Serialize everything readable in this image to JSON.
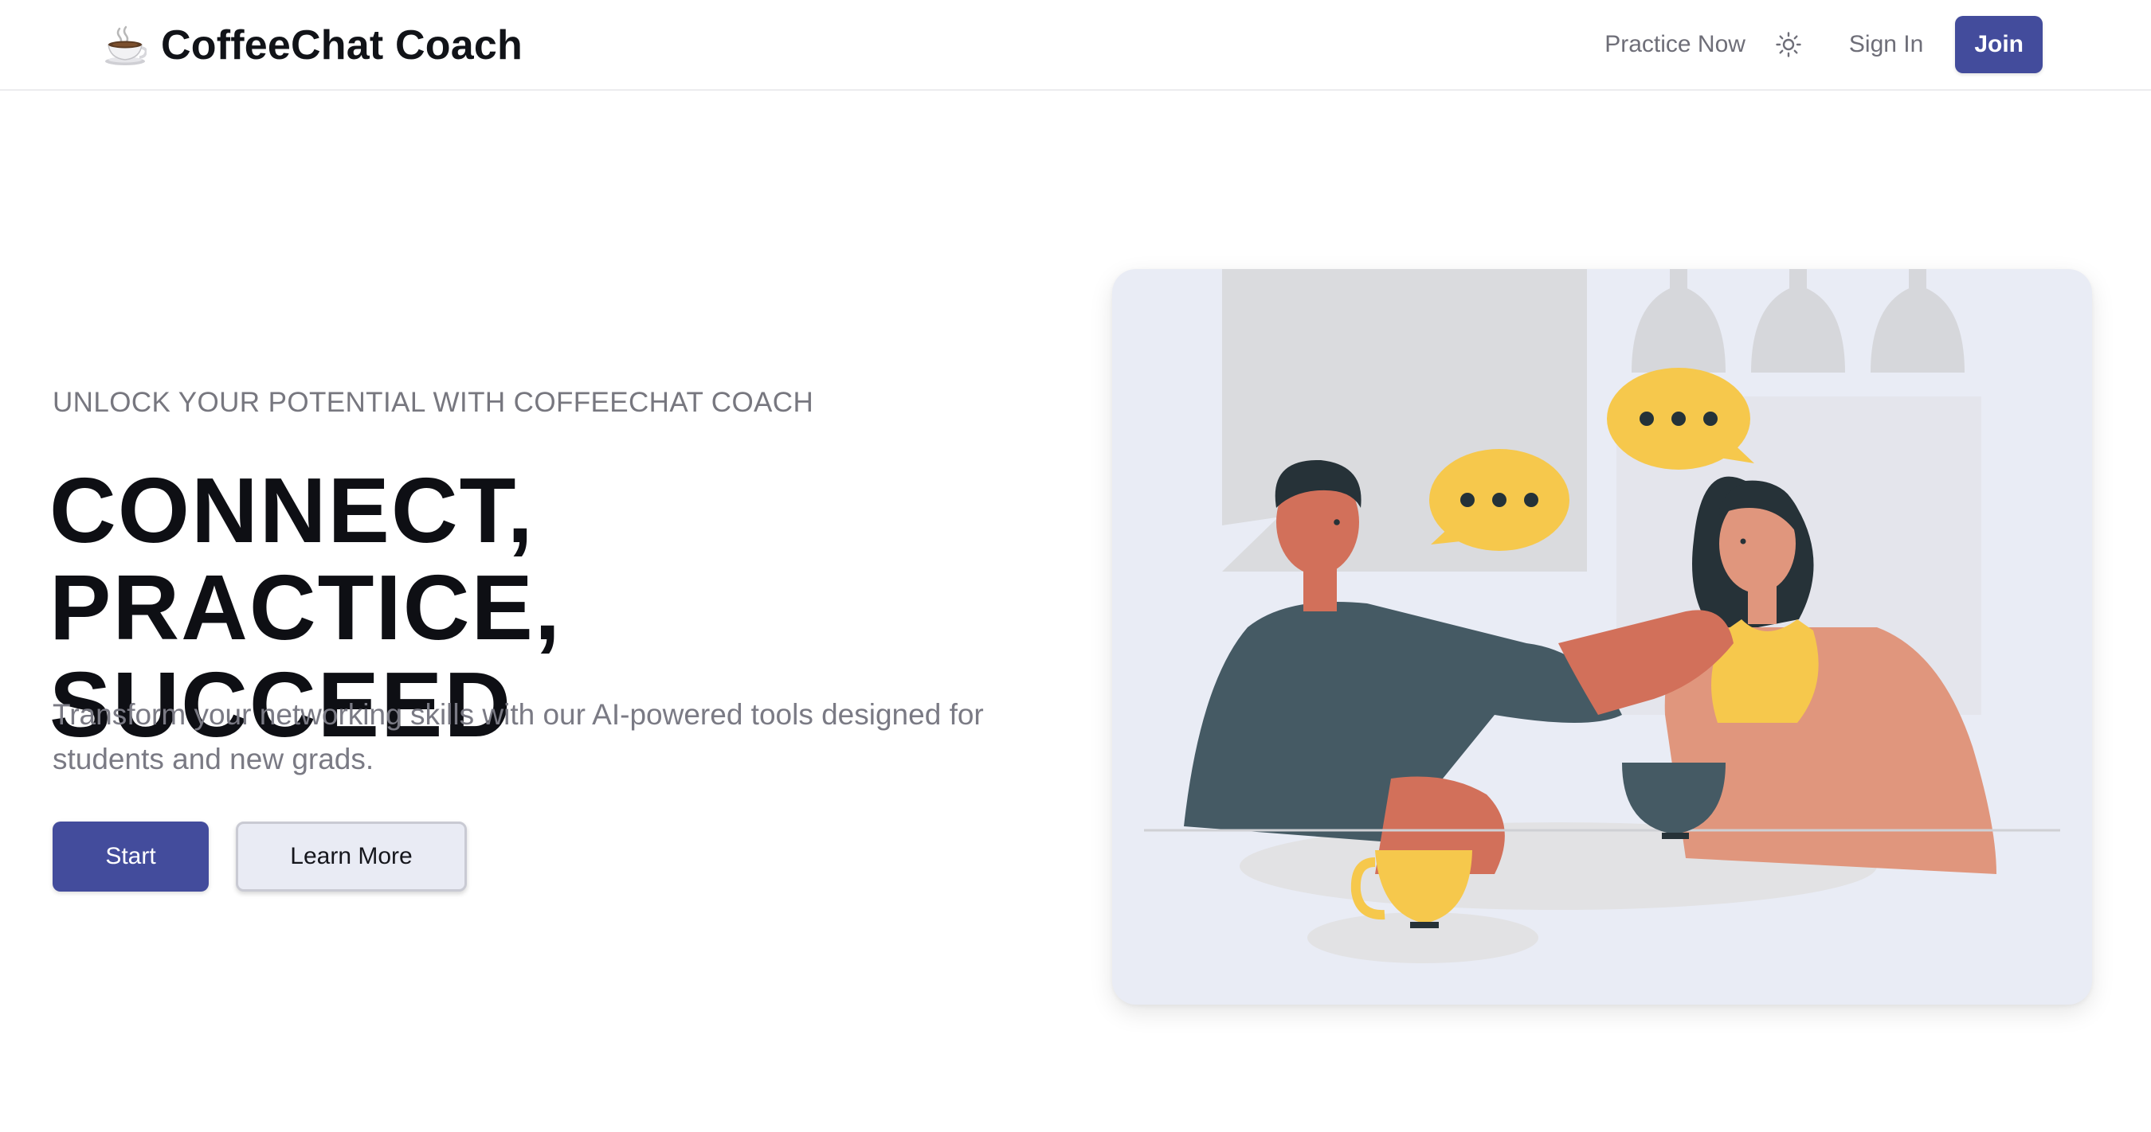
{
  "header": {
    "brand_icon": "coffee-cup-icon",
    "brand_name": "CoffeeChat Coach",
    "nav": {
      "practice_label": "Practice Now",
      "theme_icon": "sun-icon",
      "signin_label": "Sign In",
      "join_label": "Join"
    }
  },
  "hero": {
    "eyebrow": "UNLOCK YOUR POTENTIAL WITH COFFEECHAT COACH",
    "headline_line1": "CONNECT, PRACTICE,",
    "headline_line2": "SUCCEED",
    "subtext": "Transform your networking skills with our AI-powered tools designed for students and new grads.",
    "primary_cta": "Start",
    "secondary_cta": "Learn More"
  },
  "illustration": {
    "subject": "two-people-coffee-chat-illustration"
  },
  "colors": {
    "accent": "#434c9c",
    "secondary_button_bg": "#e9ebf4",
    "muted_text": "#77777f",
    "illustration_bg": "#e9ecf5",
    "speech_bubble": "#f6c84c"
  }
}
